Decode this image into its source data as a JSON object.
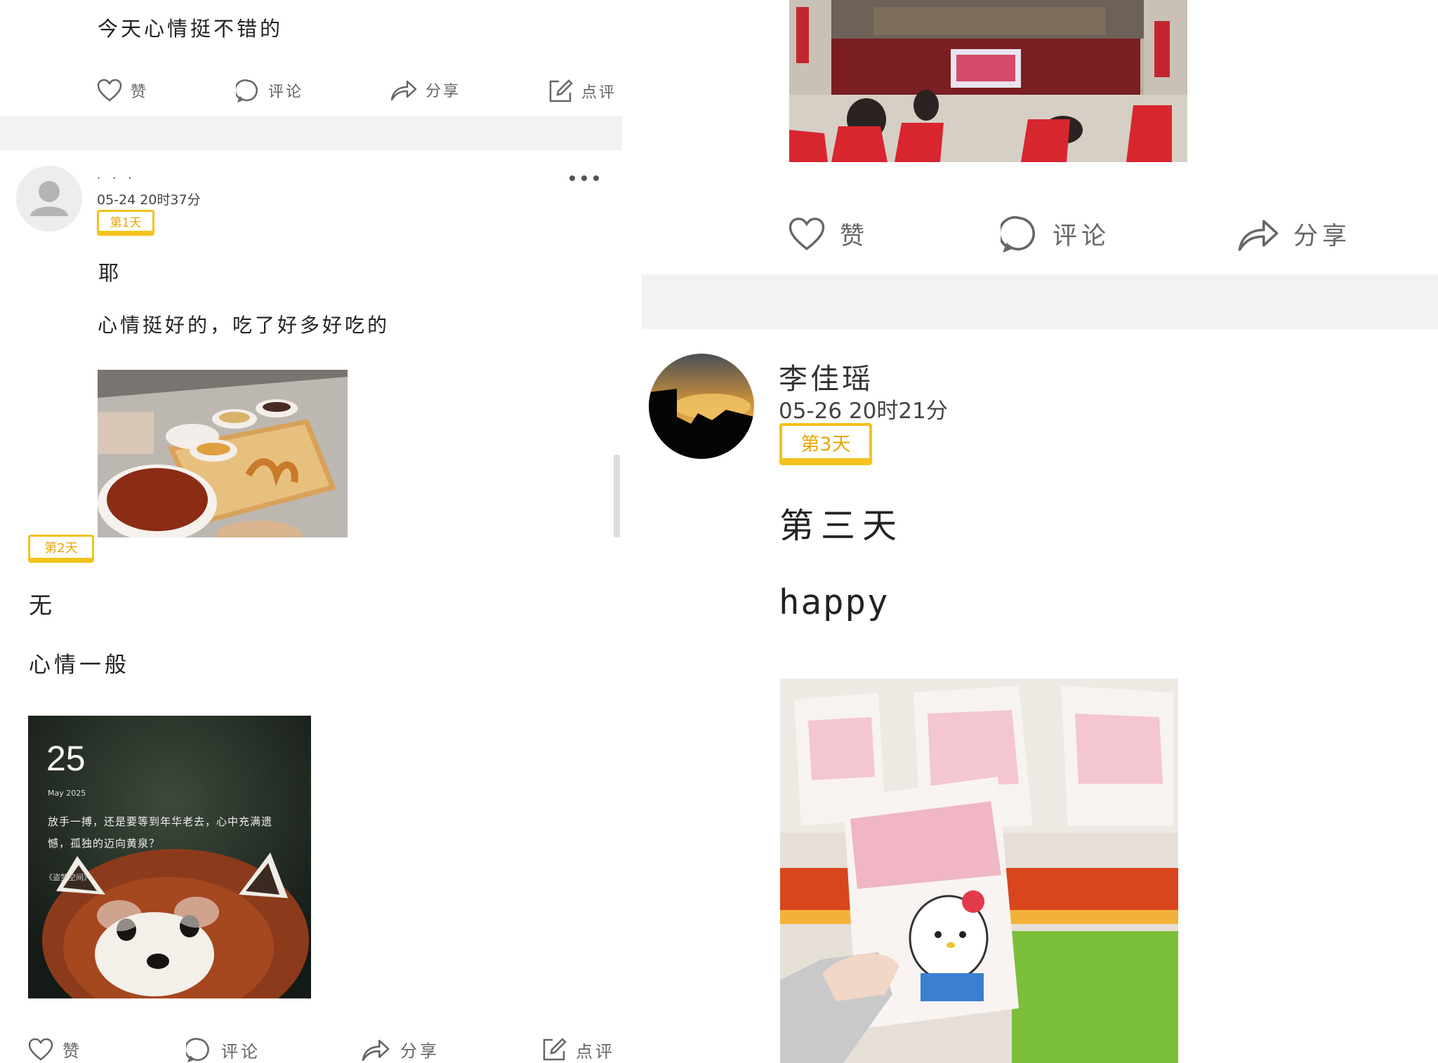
{
  "left_top_post": {
    "body": "今天心情挺不错的"
  },
  "actions": {
    "like": "赞",
    "comment": "评论",
    "share": "分享",
    "review": "点评"
  },
  "post_day1": {
    "username": "· · ·",
    "timestamp": "05-24 20时37分",
    "badge": "第1天",
    "title": "耶",
    "body": "心情挺好的，吃了好多好吃的"
  },
  "post_day2": {
    "badge": "第2天",
    "title": "无",
    "body": "心情一般",
    "image_card": {
      "day": "25",
      "month": "May 2025",
      "quote": "放手一搏，还是要等到年华老去，心中充满遗憾，孤独的迈向黄泉？",
      "source": "《盗梦空间》"
    }
  },
  "post_day3": {
    "username": "李佳瑶",
    "timestamp": "05-26 20时21分",
    "badge": "第3天",
    "title": "第三天",
    "body": "happy"
  },
  "colors": {
    "badge_yellow": "#f3c21b",
    "separator_gray": "#f2f2f2",
    "icon_gray": "#666666"
  }
}
